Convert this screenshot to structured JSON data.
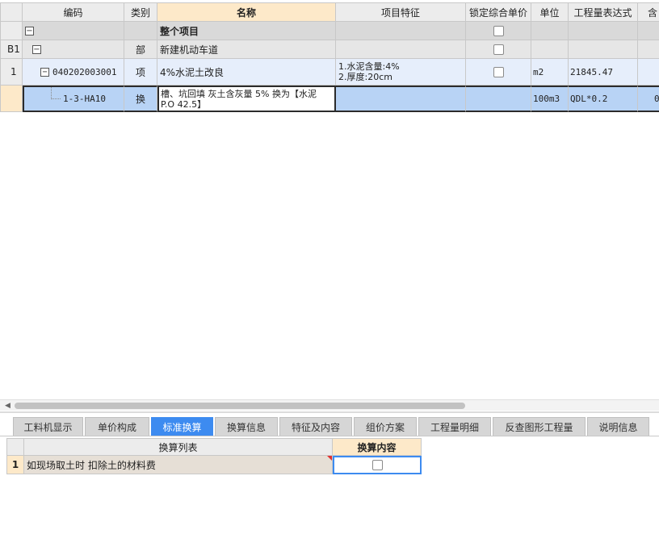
{
  "grid": {
    "columns": {
      "code": "编码",
      "type": "类别",
      "name": "名称",
      "feature": "项目特征",
      "lock_price": "锁定综合单价",
      "unit": "单位",
      "qty_expr": "工程量表达式",
      "extra": "含"
    },
    "rows": [
      {
        "index": "",
        "code": "",
        "type": "",
        "name": "整个项目",
        "feature": [],
        "unit": "",
        "qty_expr": "",
        "extra": ""
      },
      {
        "index": "B1",
        "code": "",
        "type": "部",
        "name": "新建机动车道",
        "feature": [],
        "unit": "",
        "qty_expr": "",
        "extra": ""
      },
      {
        "index": "1",
        "code": "040202003001",
        "type": "项",
        "name": "4%水泥土改良",
        "feature": [
          "1.水泥含量:4%",
          "2.厚度:20cm"
        ],
        "unit": "m2",
        "qty_expr": "21845.47",
        "extra": ""
      },
      {
        "index": "",
        "code": "1-3-HA10",
        "type": "换",
        "name_line1": "槽、坑回填 灰土含灰量 5%  换为【水泥",
        "name_line2": "P.O 42.5】",
        "unit": "100m3",
        "qty_expr": "QDL*0.2",
        "extra": "0"
      }
    ]
  },
  "tabs": [
    {
      "label": "工料机显示"
    },
    {
      "label": "单价构成"
    },
    {
      "label": "标准换算"
    },
    {
      "label": "换算信息"
    },
    {
      "label": "特征及内容"
    },
    {
      "label": "组价方案"
    },
    {
      "label": "工程量明细"
    },
    {
      "label": "反查图形工程量"
    },
    {
      "label": "说明信息"
    }
  ],
  "bottom_grid": {
    "col_list": "换算列表",
    "col_content": "换算内容",
    "rows": [
      {
        "index": "1",
        "text": "如现场取土时 扣除土的材料费"
      }
    ]
  },
  "colors": {
    "active_tab": "#3d8bf0",
    "selected_row": "#b8d3f5",
    "active_header": "#fde9c9"
  }
}
